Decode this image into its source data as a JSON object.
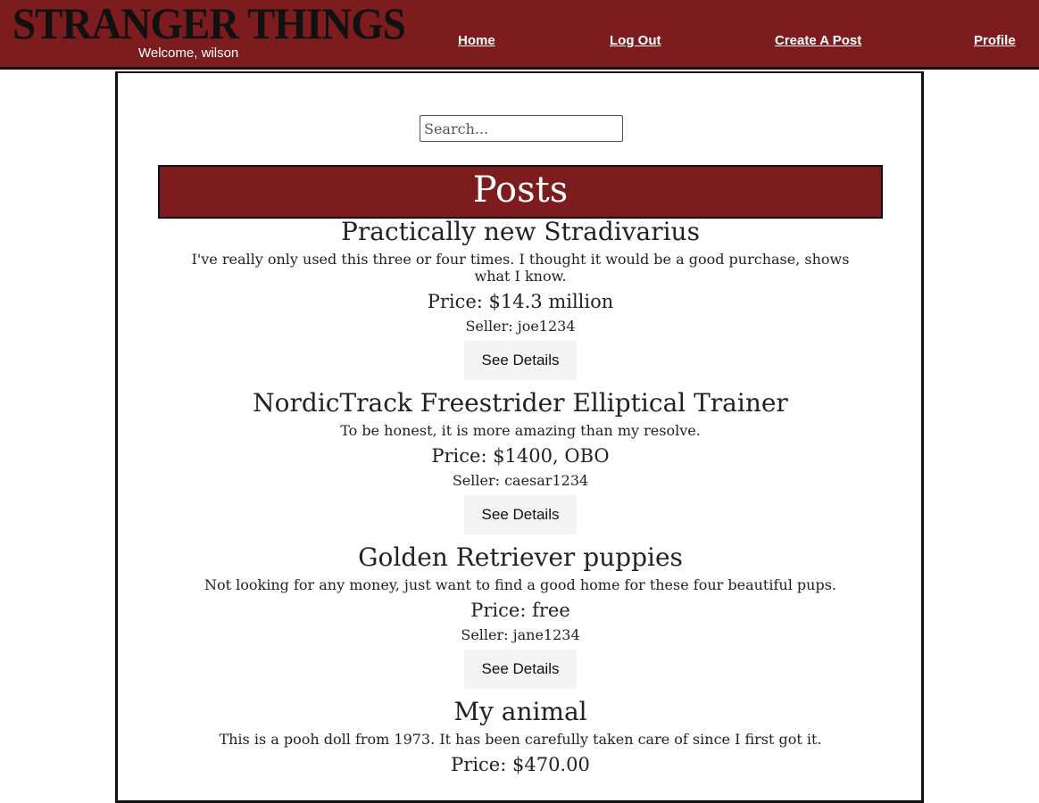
{
  "header": {
    "logo": "STRANGER THINGS",
    "welcome": "Welcome, wilson",
    "nav": [
      "Home",
      "Log Out",
      "Create A Post",
      "Profile"
    ]
  },
  "search": {
    "placeholder": "Search..."
  },
  "posts_heading": "Posts",
  "posts": [
    {
      "title": "Practically new Stradivarius",
      "description": "I've really only used this three or four times. I thought it would be a good purchase, shows what I know.",
      "price": "Price: $14.3 million",
      "seller": "Seller: joe1234",
      "button": "See Details"
    },
    {
      "title": "NordicTrack Freestrider Elliptical Trainer",
      "description": "To be honest, it is more amazing than my resolve.",
      "price": "Price: $1400, OBO",
      "seller": "Seller: caesar1234",
      "button": "See Details"
    },
    {
      "title": "Golden Retriever puppies",
      "description": "Not looking for any money, just want to find a good home for these four beautiful pups.",
      "price": "Price: free",
      "seller": "Seller: jane1234",
      "button": "See Details"
    },
    {
      "title": "My animal",
      "description": "This is a pooh doll from 1973. It has been carefully taken care of since I first got it.",
      "price": "Price: $470.00"
    }
  ],
  "colors": {
    "brand": "#7d1c1e",
    "border": "#111111",
    "button_bg": "#f4f4f4"
  }
}
